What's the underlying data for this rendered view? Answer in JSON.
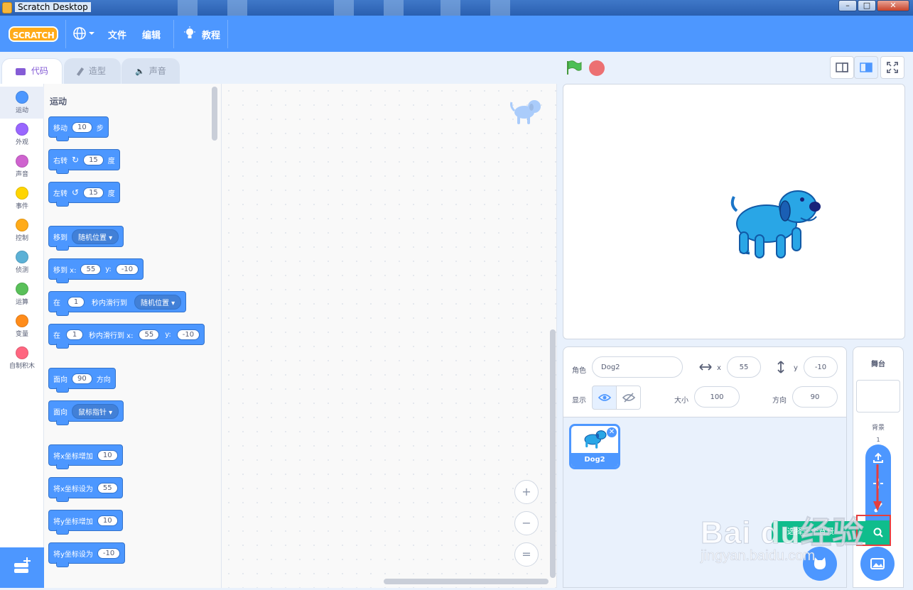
{
  "window": {
    "title": "Scratch Desktop",
    "minimize": "–",
    "maximize": "□",
    "close": "✕"
  },
  "menubar": {
    "logo": "SCRATCH",
    "file": "文件",
    "edit": "编辑",
    "tutorials": "教程"
  },
  "tabs": [
    {
      "label": "代码",
      "icon": "code-icon"
    },
    {
      "label": "造型",
      "icon": "brush-icon"
    },
    {
      "label": "声音",
      "icon": "speaker-icon"
    }
  ],
  "categories": [
    {
      "label": "运动",
      "color": "#4c97ff"
    },
    {
      "label": "外观",
      "color": "#9966ff"
    },
    {
      "label": "声音",
      "color": "#cf63cf"
    },
    {
      "label": "事件",
      "color": "#ffd500"
    },
    {
      "label": "控制",
      "color": "#ffab19"
    },
    {
      "label": "侦测",
      "color": "#5cb1d6"
    },
    {
      "label": "运算",
      "color": "#59c059"
    },
    {
      "label": "变量",
      "color": "#ff8c1a"
    },
    {
      "label": "自制积木",
      "color": "#ff6680"
    }
  ],
  "palette": {
    "section_title": "运动",
    "blocks": {
      "move": {
        "label": "移动",
        "value": "10",
        "suffix": "步"
      },
      "turn_right": {
        "label": "右转",
        "value": "15",
        "suffix": "度"
      },
      "turn_left": {
        "label": "左转",
        "value": "15",
        "suffix": "度"
      },
      "goto": {
        "label": "移到",
        "dropdown": "随机位置"
      },
      "goto_xy": {
        "label": "移到 x:",
        "x": "55",
        "y_label": "y:",
        "y": "-10"
      },
      "glide": {
        "label": "在",
        "value": "1",
        "mid": "秒内滑行到",
        "dropdown": "随机位置"
      },
      "glide_xy": {
        "label": "在",
        "value": "1",
        "mid": "秒内滑行到 x:",
        "x": "55",
        "y_label": "y:",
        "y": "-10"
      },
      "point_dir": {
        "label": "面向",
        "value": "90",
        "suffix": "方向"
      },
      "point_towards": {
        "label": "面向",
        "dropdown": "鼠标指针"
      },
      "change_x": {
        "label": "将x坐标增加",
        "value": "10"
      },
      "set_x": {
        "label": "将x坐标设为",
        "value": "55"
      },
      "change_y": {
        "label": "将y坐标增加",
        "value": "10"
      },
      "set_y": {
        "label": "将y坐标设为",
        "value": "-10"
      }
    }
  },
  "zoom": {
    "in": "+",
    "out": "−",
    "reset": "="
  },
  "sprite_info": {
    "sprite_label": "角色",
    "sprite_name": "Dog2",
    "x_label": "x",
    "x": "55",
    "y_label": "y",
    "y": "-10",
    "show_label": "显示",
    "size_label": "大小",
    "size": "100",
    "direction_label": "方向",
    "direction": "90"
  },
  "sprites": [
    {
      "name": "Dog2"
    }
  ],
  "stage_pane": {
    "header": "舞台",
    "backdrop_label": "背景",
    "backdrop_count": "1"
  },
  "tooltip": "选择一个背景",
  "watermark": {
    "brand": "Bai du经验",
    "url": "jingyan.baidu.com"
  },
  "colors": {
    "accent": "#4d97ff",
    "motion": "#4c97ff",
    "highlight": "#e63e3e",
    "search": "#0fbd8c"
  }
}
